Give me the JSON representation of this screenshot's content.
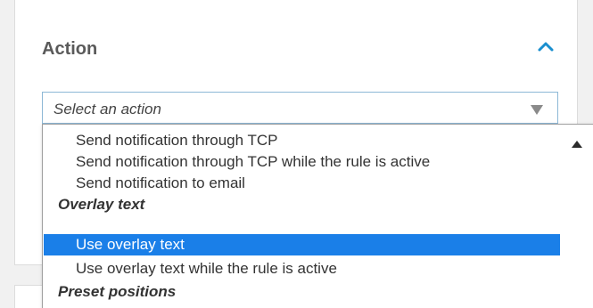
{
  "action_section": {
    "title": "Action",
    "collapse_icon": "chevron-up-icon"
  },
  "action_select": {
    "placeholder": "Select an action",
    "arrow_icon": "triangle-down-icon"
  },
  "dropdown": {
    "options": [
      {
        "label": "Send notification through TCP",
        "type": "option"
      },
      {
        "label": "Send notification through TCP while the rule is active",
        "type": "option"
      },
      {
        "label": "Send notification to email",
        "type": "option"
      },
      {
        "label": "Overlay text",
        "type": "group"
      },
      {
        "label": "Use overlay text",
        "type": "option",
        "selected": true
      },
      {
        "label": "Use overlay text while the rule is active",
        "type": "option"
      },
      {
        "label": "Preset positions",
        "type": "group"
      }
    ],
    "scroll_up_icon": "triangle-up-icon"
  },
  "colors": {
    "accent": "#1a7fe8",
    "select_border": "#8db8d6",
    "chevron": "#1a8fcf"
  }
}
